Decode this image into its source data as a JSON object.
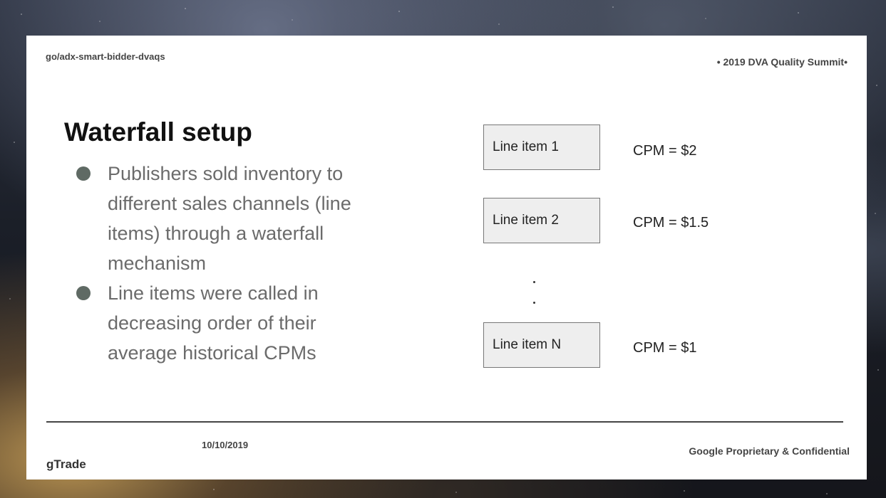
{
  "header": {
    "link": "go/adx-smart-bidder-dvaqs",
    "event": "• 2019 DVA Quality Summit•"
  },
  "title": "Waterfall setup",
  "bullets": [
    "Publishers sold inventory to different sales channels (line items) through a waterfall mechanism",
    "Line items were called in decreasing order of their average historical CPMs"
  ],
  "waterfall": {
    "items": [
      {
        "label": "Line item 1",
        "cpm": "CPM = $2"
      },
      {
        "label": "Line item 2",
        "cpm": "CPM = $1.5"
      },
      {
        "label": "Line item N",
        "cpm": "CPM = $1"
      }
    ],
    "ellipsis": ". ."
  },
  "footer": {
    "date": "10/10/2019",
    "brand": "gTrade",
    "confidential": "Google Proprietary & Confidential"
  }
}
